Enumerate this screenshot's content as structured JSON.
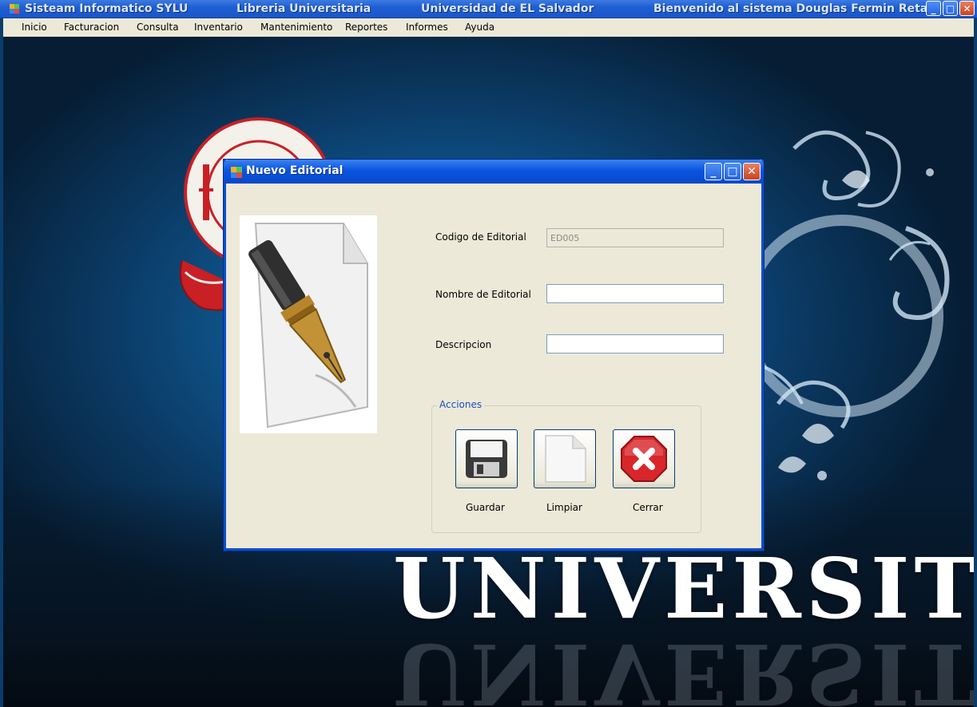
{
  "window": {
    "title_segments": [
      "Sisteam Informatico SYLU",
      "Libreria Universitaria",
      "Universidad de EL Salvador",
      "Bienvenido al sistema Douglas Fermin Reta..."
    ],
    "controls": {
      "minimize": "_",
      "maximize": "□",
      "close": "✕"
    }
  },
  "menu": [
    "Inicio",
    "Facturacion",
    "Consulta",
    "Inventario",
    "Mantenimiento",
    "Reportes",
    "Informes",
    "Ayuda"
  ],
  "background": {
    "wordmark": "UNIVERSITARIA"
  },
  "dialog": {
    "title": "Nuevo Editorial",
    "fields": {
      "codigo": {
        "label": "Codigo de Editorial",
        "value": "ED005"
      },
      "nombre": {
        "label": "Nombre de Editorial",
        "value": ""
      },
      "descripcion": {
        "label": "Descripcion",
        "value": ""
      }
    },
    "actions": {
      "group_label": "Acciones",
      "guardar": "Guardar",
      "limpiar": "Limpiar",
      "cerrar": "Cerrar"
    }
  },
  "icons": {
    "app": "windows-form-icon",
    "pen": "fountain-pen-icon",
    "save": "floppy-disk-icon",
    "clear": "blank-page-icon",
    "close": "red-x-icon"
  },
  "colors": {
    "titlebar": "#1e5fd4",
    "form_bg": "#ece9d8",
    "background": "#0f5a93",
    "close_red": "#d8262b"
  }
}
